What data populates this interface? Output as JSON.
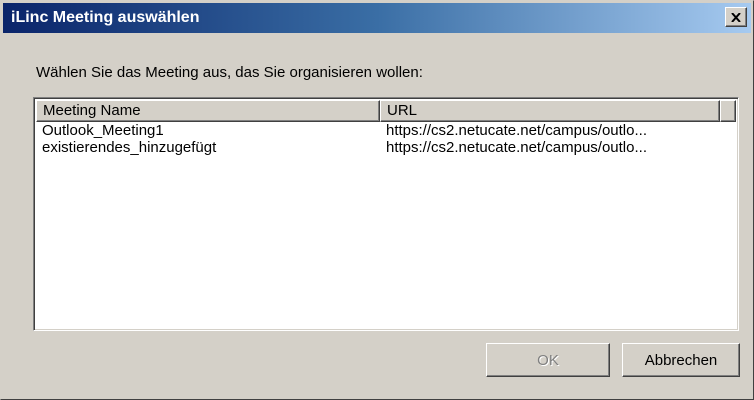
{
  "window": {
    "title": "iLinc Meeting auswählen",
    "close_icon": "close-icon"
  },
  "prompt": "Wählen Sie das Meeting aus, das Sie organisieren wollen:",
  "list": {
    "columns": [
      "Meeting Name",
      "URL"
    ],
    "rows": [
      {
        "name": "Outlook_Meeting1",
        "url": "https://cs2.netucate.net/campus/outlo..."
      },
      {
        "name": "existierendes_hinzugefügt",
        "url": "https://cs2.netucate.net/campus/outlo..."
      }
    ]
  },
  "buttons": {
    "ok_label": "OK",
    "ok_enabled": false,
    "cancel_label": "Abbrechen"
  },
  "colors": {
    "titlebar_start": "#0a246a",
    "titlebar_end": "#a6caf0",
    "face": "#d4d0c8",
    "disabled_text": "#808080"
  }
}
